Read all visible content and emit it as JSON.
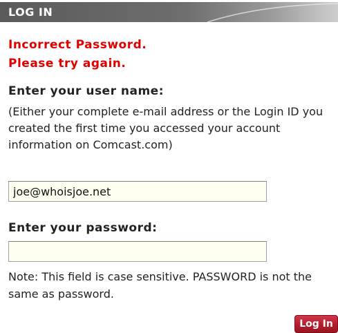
{
  "header": {
    "title": "LOG IN",
    "color_start": "#5a5a5a",
    "color_end": "#cfcfcf"
  },
  "error": {
    "line1": "Incorrect Password.",
    "line2": "Please try again.",
    "color": "#e00000"
  },
  "username": {
    "label": "Enter your user name:",
    "help": "(Either your complete e-mail address or the Login ID you created the first time you accessed your account information on Comcast.com)",
    "value": "joe@whoisjoe.net",
    "placeholder": ""
  },
  "password": {
    "label": "Enter your password:",
    "value": "",
    "placeholder": "",
    "note": "Note: This field is case sensitive. PASSWORD is not the same as password."
  },
  "login_button": {
    "label": "Log In",
    "color": "#b81e2e"
  }
}
